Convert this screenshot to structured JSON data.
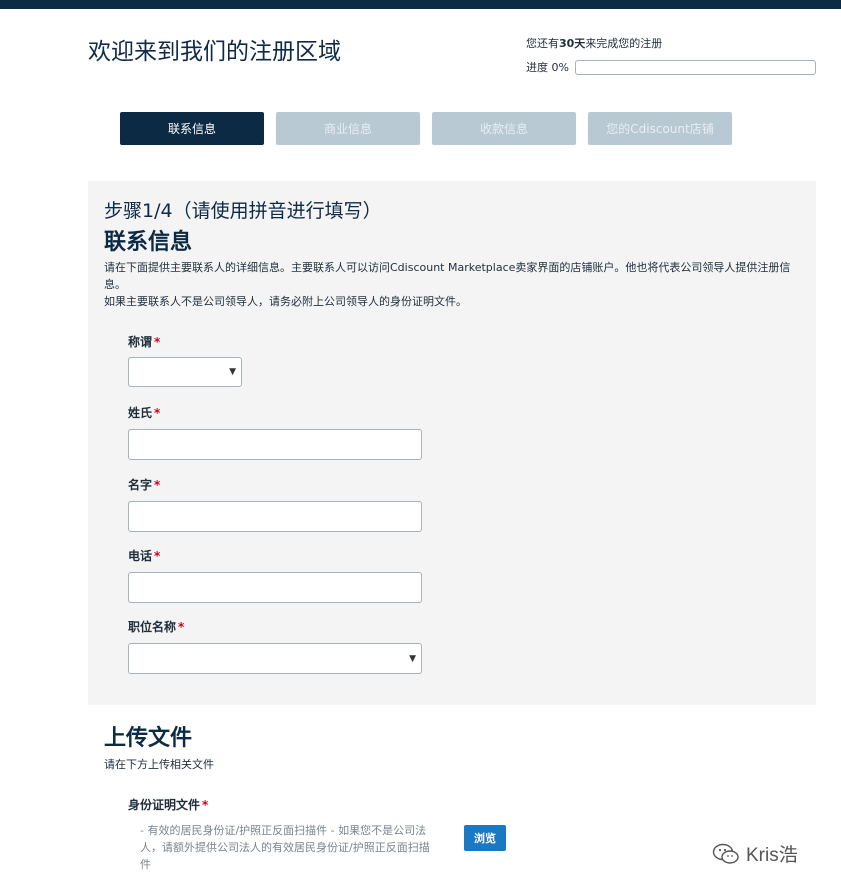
{
  "header": {
    "title": "欢迎来到我们的注册区域",
    "days_prefix": "您还有",
    "days_count": "30天",
    "days_suffix": "来完成您的注册",
    "progress_label": "进度 0%",
    "progress_value": 0
  },
  "steps": [
    {
      "label": "联系信息",
      "state": "active"
    },
    {
      "label": "商业信息",
      "state": "inactive"
    },
    {
      "label": "收款信息",
      "state": "inactive"
    },
    {
      "label": "您的Cdiscount店铺",
      "state": "inactive"
    }
  ],
  "form": {
    "step_heading": "步骤1/4（请使用拼音进行填写）",
    "section_title": "联系信息",
    "description_line1": "请在下面提供主要联系人的详细信息。主要联系人可以访问Cdiscount Marketplace卖家界面的店铺账户。他也将代表公司领导人提供注册信息。",
    "description_line2": "如果主要联系人不是公司领导人，请务必附上公司领导人的身份证明文件。",
    "required_marker": "*",
    "fields": {
      "salutation": {
        "label": "称谓",
        "value": ""
      },
      "last_name": {
        "label": "姓氏",
        "value": ""
      },
      "first_name": {
        "label": "名字",
        "value": ""
      },
      "phone": {
        "label": "电话",
        "value": ""
      },
      "job_title": {
        "label": "职位名称",
        "value": ""
      }
    },
    "dropdown_arrow": "▼"
  },
  "upload": {
    "title": "上传文件",
    "description": "请在下方上传相关文件",
    "id_label": "身份证明文件",
    "id_hint": "- 有效的居民身份证/护照正反面扫描件 - 如果您不是公司法人，请额外提供公司法人的有效居民身份证/护照正反面扫描件",
    "browse_label": "浏览"
  },
  "watermark": {
    "text": "Kris浩",
    "icon": "wechat-icon"
  },
  "colors": {
    "navy": "#0d2a44",
    "inactive_tab": "#b9c9d3",
    "required": "#d0021b",
    "button_blue": "#1b78c2"
  }
}
